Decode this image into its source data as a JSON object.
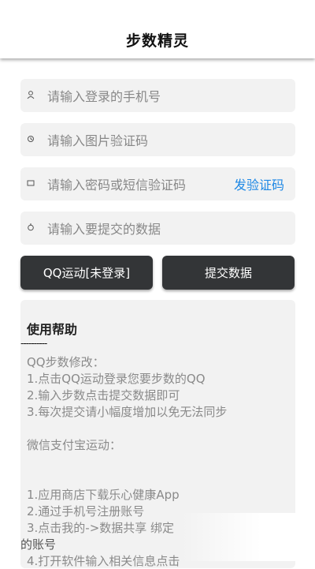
{
  "appbar": {
    "title": "步数精灵"
  },
  "form": {
    "phone": {
      "icon": "user-icon",
      "placeholder": "请输入登录的手机号"
    },
    "captcha": {
      "icon": "image-code-icon",
      "placeholder": "请输入图片验证码"
    },
    "password": {
      "icon": "lock-icon",
      "placeholder": "请输入密码或短信验证码",
      "send_code_label": "发验证码"
    },
    "steps": {
      "icon": "steps-icon",
      "placeholder": "请输入要提交的数据"
    }
  },
  "buttons": {
    "qq_login": "QQ运动[未登录]",
    "submit": "提交数据"
  },
  "help": {
    "title": "使用帮助",
    "divider": "----------",
    "lines": [
      "QQ步数修改：",
      "1.点击QQ运动登录您要步数的QQ",
      "2.输入步数点击提交数据即可",
      "3.每次提交请小幅度增加以免无法同步",
      "",
      "微信支付宝运动：",
      "",
      "1.应用商店下载乐心健康App",
      "2.通过手机号注册账号",
      "3.点击我的->数据共享 绑定",
      "的账号",
      "4.打开软件输入相关信息点击"
    ]
  },
  "colors": {
    "button_bg": "#333537",
    "link": "#1e88e5",
    "field_bg": "#f2f2f2"
  }
}
